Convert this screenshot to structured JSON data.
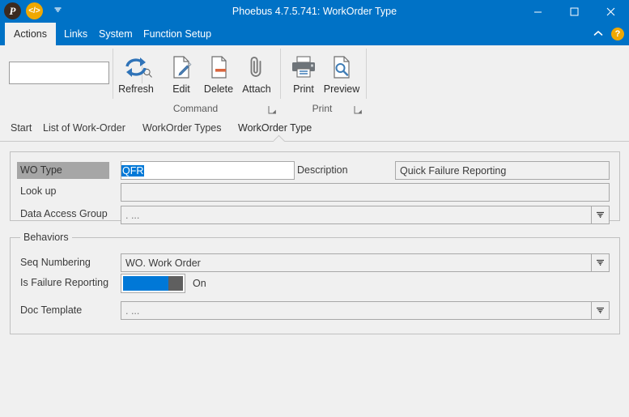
{
  "window": {
    "title": "Phoebus 4.7.5.741: WorkOrder Type",
    "quick_access": [
      {
        "name": "phoebus-logo-icon",
        "glyph": "P"
      },
      {
        "name": "code-icon",
        "glyph": "</>"
      }
    ],
    "qat_dropdown_tooltip": "Customize Quick Access Toolbar",
    "controls": {
      "minimize": "—",
      "maximize": "□",
      "close": "✕"
    },
    "accent_color": "#0072c6",
    "help_label": "?"
  },
  "ribbon": {
    "tabs": [
      {
        "label": "Actions",
        "active": true
      },
      {
        "label": "Links",
        "active": false
      },
      {
        "label": "System",
        "active": false
      },
      {
        "label": "Function Setup",
        "active": false
      }
    ],
    "search": {
      "value": "",
      "placeholder": ""
    },
    "groups": [
      {
        "label": "Command",
        "buttons": [
          {
            "label": "Refresh",
            "icon": "refresh-icon"
          },
          {
            "label": "Edit",
            "icon": "edit-icon"
          },
          {
            "label": "Delete",
            "icon": "delete-icon"
          },
          {
            "label": "Attach",
            "icon": "attach-icon"
          }
        ]
      },
      {
        "label": "Print",
        "buttons": [
          {
            "label": "Print",
            "icon": "print-icon"
          },
          {
            "label": "Preview",
            "icon": "preview-icon"
          }
        ]
      }
    ]
  },
  "page_tabs": [
    {
      "label": "Start",
      "active": false
    },
    {
      "label": "List of Work-Order",
      "active": false
    },
    {
      "label": "WorkOrder Types",
      "active": false
    },
    {
      "label": "WorkOrder Type",
      "active": true
    }
  ],
  "form": {
    "fields": {
      "wo_type": {
        "label": "WO Type",
        "value": "QFR",
        "selected": true
      },
      "description": {
        "label": "Description",
        "value": "Quick Failure Reporting"
      },
      "look_up": {
        "label": "Look up",
        "value": ""
      },
      "data_access_group": {
        "label": "Data Access Group",
        "value": ". ..."
      }
    },
    "behaviors": {
      "title": "Behaviors",
      "seq_numbering": {
        "label": "Seq Numbering",
        "value": "WO. Work Order"
      },
      "is_failure_reporting": {
        "label": "Is Failure Reporting",
        "state": "On"
      },
      "doc_template": {
        "label": "Doc Template",
        "value": ". ..."
      }
    }
  }
}
